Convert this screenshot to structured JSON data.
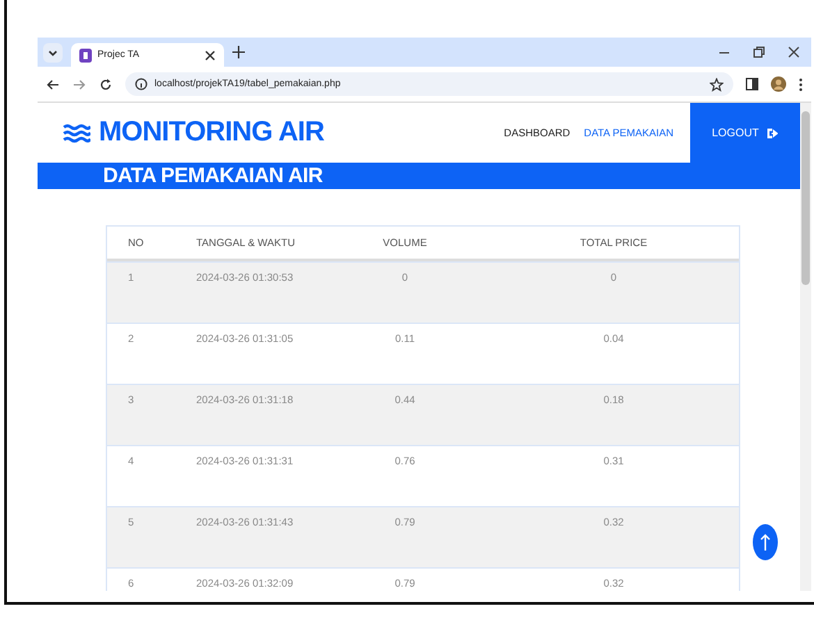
{
  "browser": {
    "tabs": [
      {
        "title": "Projec TA",
        "selected": true
      }
    ],
    "address": "localhost/projekTA19/tabel_pemakaian.php"
  },
  "header": {
    "logo": "MONITORING AIR",
    "nav": [
      {
        "label": "DASHBOARD",
        "selected": false
      },
      {
        "label": "DATA PEMAKAIAN",
        "selected": true
      }
    ],
    "logout": "LOGOUT"
  },
  "banner": "DATA PEMAKAIAN AIR",
  "table": {
    "columns": [
      "NO",
      "TANGGAL & WAKTU",
      "VOLUME",
      "TOTAL PRICE"
    ],
    "rows": [
      [
        "1",
        "2024-03-26 01:30:53",
        "0",
        "0"
      ],
      [
        "2",
        "2024-03-26 01:31:05",
        "0.11",
        "0.04"
      ],
      [
        "3",
        "2024-03-26 01:31:18",
        "0.44",
        "0.18"
      ],
      [
        "4",
        "2024-03-26 01:31:31",
        "0.76",
        "0.31"
      ],
      [
        "5",
        "2024-03-26 01:31:43",
        "0.79",
        "0.32"
      ],
      [
        "6",
        "2024-03-26 01:32:09",
        "0.79",
        "0.32"
      ]
    ]
  }
}
